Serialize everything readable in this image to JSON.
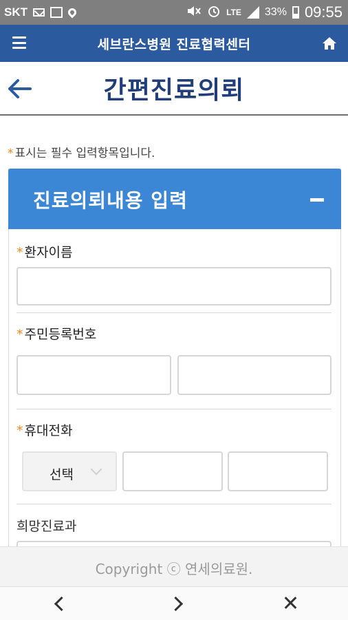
{
  "status_bar": {
    "carrier": "SKT",
    "network": "LTE",
    "battery": "33%",
    "time": "09:55",
    "icons": [
      "mail-icon",
      "image-icon",
      "location-icon",
      "mute-icon",
      "alarm-icon",
      "signal-icon",
      "battery-icon"
    ]
  },
  "header": {
    "title": "세브란스병원 진료협력센터",
    "menu_icon": "hamburger-menu-icon",
    "home_icon": "home-icon",
    "color": "#2b5a9f"
  },
  "page": {
    "title": "간편진료의뢰",
    "back_icon": "back-arrow-icon",
    "title_color": "#223e79"
  },
  "required_note": {
    "star": "*",
    "text": "표시는 필수 입력항목입니다."
  },
  "panel": {
    "title": "진료의뢰내용 입력",
    "collapse_icon": "minus-icon",
    "color": "#3b87d6"
  },
  "form": {
    "required_star": "*",
    "patient_name": {
      "label": "환자이름",
      "value": ""
    },
    "resident_number": {
      "label": "주민등록번호",
      "part1": "",
      "part2": ""
    },
    "mobile": {
      "label": "휴대전화",
      "select_value": "선택",
      "part2": "",
      "part3": ""
    },
    "department": {
      "label": "희망진료과"
    }
  },
  "footer": {
    "copyright": "Copyright ⓒ 연세의료원."
  },
  "browser_nav": {
    "icons": [
      "back-chevron-icon",
      "forward-chevron-icon",
      "close-icon"
    ]
  }
}
